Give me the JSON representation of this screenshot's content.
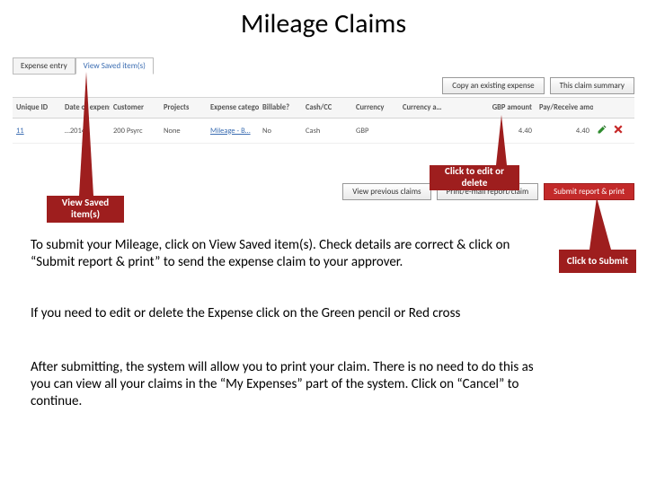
{
  "title": "Mileage Claims",
  "tabs": {
    "entry": "Expense entry",
    "saved": "View Saved item(s)"
  },
  "topButtons": {
    "copy": "Copy an existing expense",
    "summary": "This claim summary"
  },
  "gridHeaders": {
    "unique": "Unique ID",
    "date": "Date of expense",
    "customer": "Customer",
    "projects": "Projects",
    "category": "Expense category",
    "billable": "Billable?",
    "cash": "Cash/CC",
    "currency": "Currency",
    "camount": "Currency a…",
    "gbp": "GBP amount",
    "pay": "Pay/Receive amount"
  },
  "row": {
    "unique": "11",
    "date": "…2014",
    "customer": "200 Psyrc",
    "projects": "None",
    "category": "Mileage - B…",
    "billable": "No",
    "cash": "Cash",
    "currency": "GBP",
    "camount": "",
    "gbp": "4.40",
    "pay": "4.40"
  },
  "buttons": {
    "viewPrev": "View previous claims",
    "print": "Print/e-mail report/claim",
    "submit": "Submit report & print"
  },
  "callouts": {
    "edit": "Click to edit or delete",
    "saved": "View Saved item(s)",
    "submit": "Click to Submit"
  },
  "paras": {
    "p1": "To submit your Mileage, click on View Saved item(s). Check details are correct & click on “Submit report & print” to send the expense claim to your approver.",
    "p2": "If you need to edit or delete the Expense click on the Green pencil or Red cross",
    "p3": "After submitting, the system will allow you to print your claim. There is no need to do this as you can view all your claims in the “My Expenses” part of the system. Click on “Cancel” to continue."
  }
}
